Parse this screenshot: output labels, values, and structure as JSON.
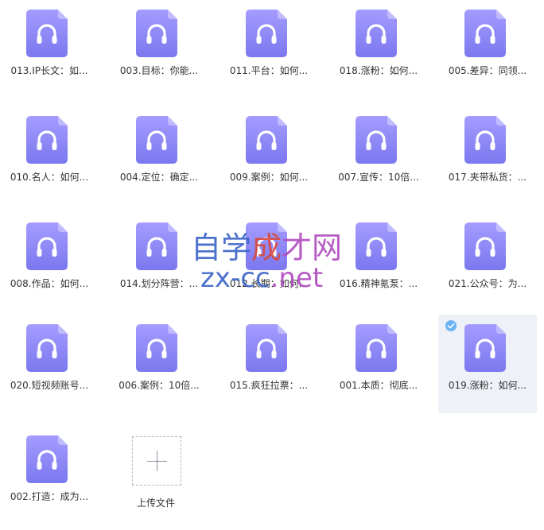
{
  "files": [
    {
      "name": "013.IP长文：如..."
    },
    {
      "name": "003.目标：你能..."
    },
    {
      "name": "011.平台：如何..."
    },
    {
      "name": "018.涨粉：如何..."
    },
    {
      "name": "005.差异：同领..."
    },
    {
      "name": "010.名人：如何..."
    },
    {
      "name": "004.定位：确定..."
    },
    {
      "name": "009.案例：如何..."
    },
    {
      "name": "007.宣传：10倍..."
    },
    {
      "name": "017.夹带私货：..."
    },
    {
      "name": "008.作品：如何..."
    },
    {
      "name": "014.划分阵营：..."
    },
    {
      "name": "012.长期：如何..."
    },
    {
      "name": "016.精神氪泵：..."
    },
    {
      "name": "021.公众号：为..."
    },
    {
      "name": "020.短视频账号..."
    },
    {
      "name": "006.案例：10倍..."
    },
    {
      "name": "015.疯狂拉票：..."
    },
    {
      "name": "001.本质：彻底..."
    },
    {
      "name": "019.涨粉：如何...",
      "selected": true
    },
    {
      "name": "002.打造：成为..."
    }
  ],
  "upload": {
    "label": "上传文件"
  },
  "watermark": {
    "line1_part1": "自学",
    "line1_part2": "成",
    "line1_part3": "才网",
    "line2_part1": "zx-cc",
    "line2_part2": ".net"
  },
  "colors": {
    "icon_gradient_top": "#a59cff",
    "icon_gradient_bottom": "#7b78ef",
    "selected_bg": "#eef1f7",
    "check_badge": "#6cb4f5"
  }
}
